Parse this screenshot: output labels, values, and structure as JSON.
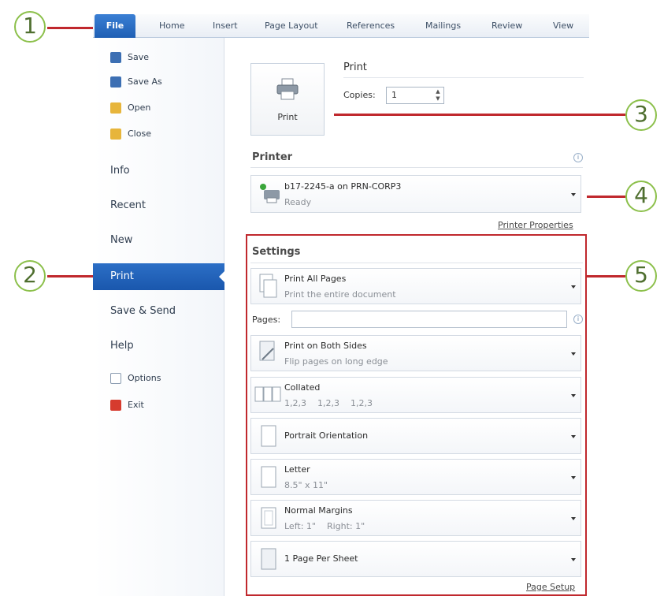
{
  "ribbon": {
    "tabs": [
      "File",
      "Home",
      "Insert",
      "Page Layout",
      "References",
      "Mailings",
      "Review",
      "View"
    ]
  },
  "backstage": {
    "commands": [
      {
        "label": "Save",
        "icon": "save-icon"
      },
      {
        "label": "Save As",
        "icon": "save-as-icon"
      },
      {
        "label": "Open",
        "icon": "open-folder-icon"
      },
      {
        "label": "Close",
        "icon": "close-folder-icon"
      }
    ],
    "nav": [
      "Info",
      "Recent",
      "New",
      "Print",
      "Save & Send",
      "Help"
    ],
    "selected": "Print",
    "footer_commands": [
      {
        "label": "Options",
        "icon": "options-icon"
      },
      {
        "label": "Exit",
        "icon": "exit-icon"
      }
    ]
  },
  "print": {
    "button_label": "Print",
    "heading": "Print",
    "copies_label": "Copies:",
    "copies_value": "1"
  },
  "printer": {
    "heading": "Printer",
    "name": "b17-2245-a on PRN-CORP3",
    "status": "Ready",
    "properties_link": "Printer Properties"
  },
  "settings": {
    "heading": "Settings",
    "pages_label": "Pages:",
    "pages_value": "",
    "options": [
      {
        "title": "Print All Pages",
        "subtitle": "Print the entire document"
      },
      {
        "title": "Print on Both Sides",
        "subtitle": "Flip pages on long edge"
      },
      {
        "title": "Collated",
        "subtitle": "1,2,3    1,2,3    1,2,3"
      },
      {
        "title": "Portrait Orientation",
        "subtitle": ""
      },
      {
        "title": "Letter",
        "subtitle": "8.5\" x 11\""
      },
      {
        "title": "Normal Margins",
        "subtitle": "Left: 1\"    Right: 1\""
      },
      {
        "title": "1 Page Per Sheet",
        "subtitle": ""
      }
    ],
    "page_setup_link": "Page Setup"
  },
  "callouts": [
    "1",
    "2",
    "3",
    "4",
    "5"
  ],
  "colors": {
    "file_tab": "#1f5fb4",
    "selected_nav": "#1a57ad",
    "callout_ring": "#8cc04b",
    "callout_line": "#c0282d"
  }
}
